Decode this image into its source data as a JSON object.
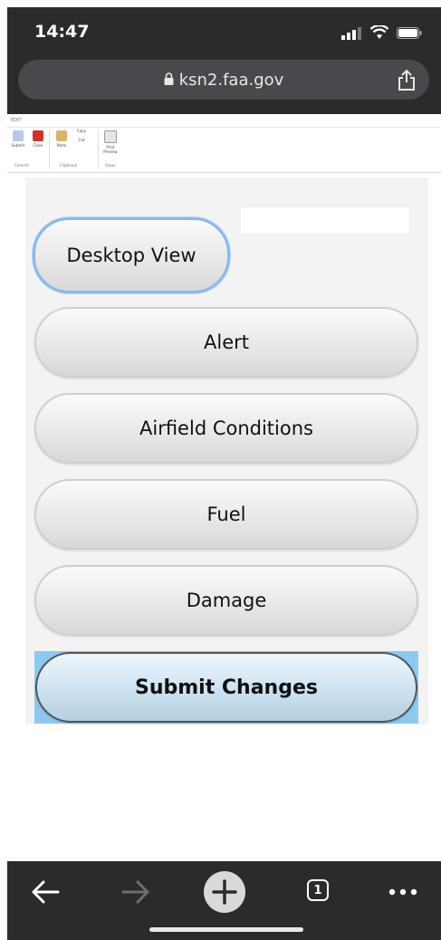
{
  "status_bar": {
    "time": "14:47"
  },
  "browser": {
    "url": "ksn2.faa.gov",
    "tab_count": "1"
  },
  "ribbon": {
    "tab": "EDIT",
    "buttons": [
      "Submit",
      "Close",
      "Paste",
      "Copy",
      "Cut",
      "Print Preview"
    ],
    "groups": [
      "Commit",
      "Clipboard",
      "Views"
    ]
  },
  "form": {
    "textbox_value": "",
    "buttons": {
      "desktop_view": "Desktop View",
      "alert": "Alert",
      "airfield_conditions": "Airfield Conditions",
      "fuel": "Fuel",
      "damage": "Damage",
      "submit_changes": "Submit Changes"
    }
  },
  "colors": {
    "browser_chrome": "#2a2b2d",
    "url_bar": "#48494c",
    "submit_highlight": "#8cc9f0",
    "desktop_button_border": "#8ab8f0"
  }
}
